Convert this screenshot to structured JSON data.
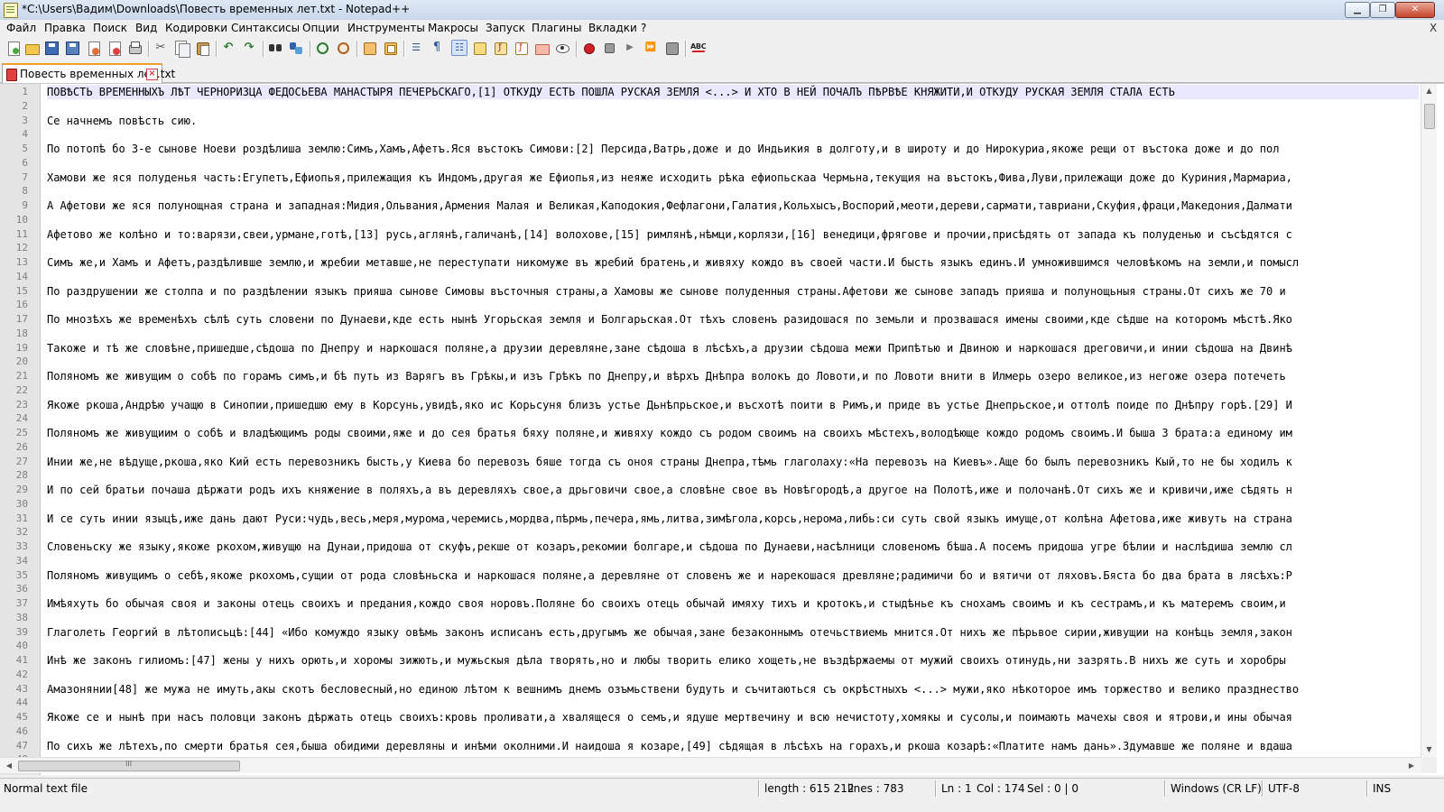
{
  "window": {
    "title": "*C:\\Users\\Вадим\\Downloads\\Повесть временных лет.txt - Notepad++"
  },
  "menu": [
    "Файл",
    "Правка",
    "Поиск",
    "Вид",
    "Кодировки",
    "Синтаксисы",
    "Опции",
    "Инструменты",
    "Макросы",
    "Запуск",
    "Плагины",
    "Вкладки",
    "?"
  ],
  "menu_close": "X",
  "toolbar_icons": [
    "new-file-icon",
    "open-folder-icon",
    "save-icon",
    "save-all-icon",
    "close-icon",
    "close-all-icon",
    "print-icon",
    "cut-icon",
    "copy-icon",
    "paste-icon",
    "undo-icon",
    "redo-icon",
    "find-icon",
    "replace-icon",
    "zoom-in-icon",
    "zoom-out-icon",
    "sync-vertical-icon",
    "sync-horizontal-icon",
    "word-wrap-icon",
    "show-all-chars-icon",
    "indent-guide-icon",
    "doc-map-icon",
    "function-list-icon",
    "folder-workspace-icon",
    "monitor-icon",
    "eye-icon",
    "record-macro-icon",
    "stop-macro-icon",
    "play-macro-icon",
    "run-macro-multiple-icon",
    "save-macro-icon",
    "spell-check-icon"
  ],
  "tab": {
    "label": "Повесть временных лет.txt"
  },
  "colors": {
    "current_line": "#e8e8ff",
    "tab_accent": "#f0a030",
    "gutter": "#e4e4e4"
  },
  "editor": {
    "lines": [
      {
        "n": "1",
        "text": "ПОВѢСТЬ ВРЕМЕННЫХЪ ЛѢТ ЧЕРНОРИЗЦА ФЕДОСЬЕВА МАНАСТЫРЯ ПЕЧЕРЬСКАГО,[1] ОТКУДУ ЕСТЬ ПОШЛА РУСКАЯ ЗЕМЛЯ <...> И ХТО В НЕЙ ПОЧАЛЪ ПѢРВѢЕ КНЯЖИТИ,И ОТКУДУ РУСКАЯ ЗЕМЛЯ СТАЛА ЕСТЬ"
      },
      {
        "n": "2",
        "text": ""
      },
      {
        "n": "3",
        "text": "Се начнемъ повѣсть сию."
      },
      {
        "n": "4",
        "text": ""
      },
      {
        "n": "5",
        "text": "По потопѣ бо 3-е сынове Ноеви роздѣлиша землю:Симъ,Хамъ,Афетъ.Яся въстокъ Симови:[2] Персида,Ватрь,доже и до Индьикия в долготу,и в широту и до Нирокуриа,якоже рещи от въстока доже и до пол"
      },
      {
        "n": "6",
        "text": ""
      },
      {
        "n": "7",
        "text": "Хамови же яся полуденья часть:Егупетъ,Ефиопья,прилежащия къ Индомъ,другая же Ефиопья,из неяже исходить рѣка ефиопьскаа Чермьна,текущия на въстокъ,Фива,Луви,прилежащи доже до Куриния,Мармариа,"
      },
      {
        "n": "8",
        "text": ""
      },
      {
        "n": "9",
        "text": "А Афетови же яся полунощная страна и западная:Мидия,Ольвания,Армения Малая и Великая,Каподокия,Фефлагони,Галатия,Кольхысъ,Воспорий,меоти,дереви,сармати,тавриани,Скуфия,фраци,Македония,Далмати"
      },
      {
        "n": "10",
        "text": ""
      },
      {
        "n": "11",
        "text": "Афетово же колѣно и то:варязи,свеи,урмане,готѣ,[13] русь,аглянѣ,галичанѣ,[14] волохове,[15] римлянѣ,нѣмци,корлязи,[16] венедици,фрягове и прочии,присѣдять от запада къ полуденью и съсѣдятся с"
      },
      {
        "n": "12",
        "text": ""
      },
      {
        "n": "13",
        "text": "Симъ же,и Хамъ и Афетъ,раздѣливше землю,и жребии метавше,не переступати никомуже въ жребий братень,и живяху кождо въ своей части.И бысть языкъ единъ.И умножившимся человѣкомъ на земли,и помысл"
      },
      {
        "n": "14",
        "text": ""
      },
      {
        "n": "15",
        "text": "По раздрушении же столпа и по раздѣлении языкъ прияша сынове Симовы въсточныя страны,а Хамовы же сынове полуденныя страны.Афетови же сынове западъ прияша и полунощьныя страны.От сихъ же 70 и"
      },
      {
        "n": "16",
        "text": ""
      },
      {
        "n": "17",
        "text": "По мнозѣхъ же временѣхъ сѣлѣ суть словени по Дунаеви,кде есть нынѣ Угорьская земля и Болгарьская.От тѣхъ словенъ разидошася по земьли и прозвашася имены своими,кде сѣдше на которомъ мѣстѣ.Яко"
      },
      {
        "n": "18",
        "text": ""
      },
      {
        "n": "19",
        "text": "Такоже и тѣ же словѣне,пришедше,сѣдоша по Днепру и наркошася поляне,а друзии деревляне,зане сѣдоша в лѣсѣхъ,а друзии сѣдоша межи Припѣтью и Двиною и наркошася дреговичи,и инии сѣдоша на Двинѣ"
      },
      {
        "n": "20",
        "text": ""
      },
      {
        "n": "21",
        "text": "Поляномъ же живущим о собѣ по горамъ симъ,и бѣ путь из Варягъ въ Грѣкы,и изъ Грѣкъ по Днепру,и вѣрхъ Днѣпра волокъ до Ловоти,и по Ловоти внити в Илмерь озеро великое,из негоже озера потечеть"
      },
      {
        "n": "22",
        "text": ""
      },
      {
        "n": "23",
        "text": "Якоже ркоша,Андрѣю учащю в Синопии,пришедшю ему в Корсунь,увидѣ,яко ис Корьсуня близъ устье Дьнѣпрьское,и въсхотѣ поити в Римъ,и приде въ устье Днепрьское,и оттолѣ поиде по Днѣпру горѣ.[29] И"
      },
      {
        "n": "24",
        "text": ""
      },
      {
        "n": "25",
        "text": "Поляномъ же живущиим о собѣ и владѣющимъ роды своими,яже и до сея братья бяху поляне,и живяху кождо съ родом своимъ на своихъ мѣстехъ,володѣюще кождо родомъ своимъ.И быша 3 брата:а единому им"
      },
      {
        "n": "26",
        "text": ""
      },
      {
        "n": "27",
        "text": "Инии же,не вѣдуще,ркоша,яко Кий есть перевозникъ бысть,у Киева бо перевозъ бяше тогда съ оноя страны Днепра,тѣмь глаголаху:«На перевозъ на Киевъ».Аще бо былъ перевозникъ Кый,то не бы ходилъ к"
      },
      {
        "n": "28",
        "text": ""
      },
      {
        "n": "29",
        "text": "И по сей братьи почаша дѣржати родъ ихъ княжение в поляхъ,а въ деревляхъ свое,а дрьговичи свое,а словѣне свое въ Новѣгородѣ,а другое на Полотѣ,иже и полочанѣ.От сихъ же и кривичи,иже сѣдять н"
      },
      {
        "n": "30",
        "text": ""
      },
      {
        "n": "31",
        "text": "И се суть инии языцѣ,иже дань дают Руси:чудь,весь,меря,мурома,черемись,мордва,пѣрмь,печера,ямь,литва,зимѣгола,корсь,нерома,либь:си суть свой языкъ имуще,от колѣна Афетова,иже живуть на страна"
      },
      {
        "n": "32",
        "text": ""
      },
      {
        "n": "33",
        "text": "Словеньску же языку,якоже ркохом,живущю на Дунаи,придоша от скуфъ,рекше от козаръ,рекомии болгаре,и сѣдоша по Дунаеви,насѣлници словеномъ бѣша.А посемъ придоша угре бѣлии и наслѣдиша землю сл"
      },
      {
        "n": "34",
        "text": ""
      },
      {
        "n": "35",
        "text": "Поляномъ живущимъ о себѣ,якоже ркохомъ,сущии от рода словѣньска и наркошася поляне,а деревляне от словенъ же и нарекошася древляне;радимичи бо и вятичи от ляховъ.Бяста бо два брата в лясѣхъ:Р"
      },
      {
        "n": "36",
        "text": ""
      },
      {
        "n": "37",
        "text": "Имѣяхуть бо обычая своя и законы отець своихъ и предания,кождо своя норовъ.Поляне бо своихъ отець обычай имяху тихъ и кротокъ,и стыдѣнье къ снохамъ своимъ и къ сестрамъ,и къ матеремъ своим,и"
      },
      {
        "n": "38",
        "text": ""
      },
      {
        "n": "39",
        "text": "Глаголеть Георгий в лѣтописьцѣ:[44] «Ибо комуждо языку овѣмь законъ исписанъ есть,другымъ же обычая,зане безаконнымъ отечьствиемь мнится.От нихъ же пѣрьвое сирии,живущии на конѣць земля,закон"
      },
      {
        "n": "40",
        "text": ""
      },
      {
        "n": "41",
        "text": "Инѣ же законъ гилиомъ:[47] жены у нихъ орють,и хоромы зижють,и мужьскыя дѣла творять,но и любы творить елико хощеть,не въздѣржаемы от мужий своихъ отинудь,ни зазрять.В нихъ же суть и хоробры"
      },
      {
        "n": "42",
        "text": ""
      },
      {
        "n": "43",
        "text": "Амазонянии[48] же мужа не имуть,акы скотъ бесловесный,но единою лѣтом к вешнимъ днемъ озъмьствени будуть и съчитаються съ окрѣстныхъ <...> мужи,яко нѣкоторое имъ торжество и велико празднество"
      },
      {
        "n": "44",
        "text": ""
      },
      {
        "n": "45",
        "text": "Якоже се и нынѣ при насъ половци законъ дѣржать отець своихъ:кровь проливати,а хвалящеся о семъ,и ядуше мертвечину и всю нечистоту,хомякы и сусолы,и поимають мачехы своя и ятрови,и ины обычая"
      },
      {
        "n": "46",
        "text": ""
      },
      {
        "n": "47",
        "text": "По сихъ же лѣтехъ,по смерти братья сея,быша обидими деревляны и инѣми околними.И наидоша я козаре,[49] сѣдящая в лѣсѣхъ на горахъ,и ркоша козарѣ:«Платите намъ дань».Здумавше же поляне и вдаша"
      },
      {
        "n": "48",
        "text": ""
      }
    ]
  },
  "hscroll_grip": "III",
  "status": {
    "file_type": "Normal text file",
    "length": "length : 615 212",
    "lines": "lines : 783",
    "ln": "Ln : 1",
    "col": "Col : 174",
    "sel": "Sel : 0 | 0",
    "eol": "Windows (CR LF)",
    "encoding": "UTF-8",
    "mode": "INS"
  }
}
